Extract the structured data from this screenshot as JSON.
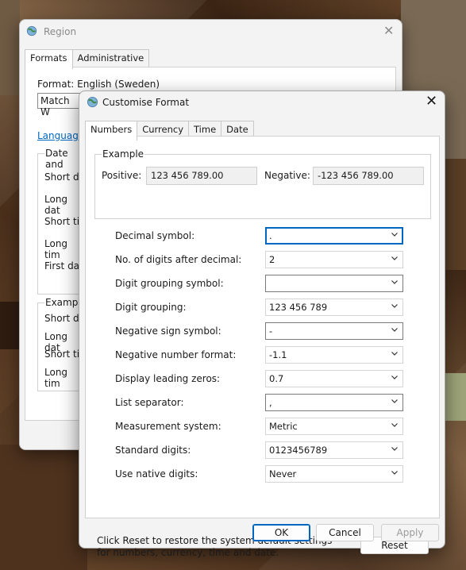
{
  "region_window": {
    "title": "Region",
    "tabs": [
      "Formats",
      "Administrative"
    ],
    "format_label": "Format: English (Sweden)",
    "format_select_value": "Match W",
    "language_link": "Language",
    "date_group_legend": "Date and",
    "date_rows": [
      "Short da",
      "Long dat",
      "Short tin",
      "Long tim",
      "First day"
    ],
    "examples_legend": "Example",
    "example_rows": [
      "Short da",
      "Long dat",
      "Short tin",
      "Long tim"
    ]
  },
  "dialog": {
    "title": "Customise Format",
    "tabs": [
      "Numbers",
      "Currency",
      "Time",
      "Date"
    ],
    "example": {
      "legend": "Example",
      "positive_label": "Positive:",
      "positive_value": "123 456 789.00",
      "negative_label": "Negative:",
      "negative_value": "-123 456 789.00"
    },
    "settings": [
      {
        "label": "Decimal symbol:",
        "value": ".",
        "editable": true,
        "focused": true
      },
      {
        "label": "No. of digits after decimal:",
        "value": "2",
        "editable": false,
        "focused": false
      },
      {
        "label": "Digit grouping symbol:",
        "value": "",
        "editable": true,
        "focused": false
      },
      {
        "label": "Digit grouping:",
        "value": "123 456 789",
        "editable": false,
        "focused": false
      },
      {
        "label": "Negative sign symbol:",
        "value": "-",
        "editable": true,
        "focused": false
      },
      {
        "label": "Negative number format:",
        "value": "-1.1",
        "editable": false,
        "focused": false
      },
      {
        "label": "Display leading zeros:",
        "value": "0.7",
        "editable": false,
        "focused": false
      },
      {
        "label": "List separator:",
        "value": ",",
        "editable": true,
        "focused": false
      },
      {
        "label": "Measurement system:",
        "value": "Metric",
        "editable": false,
        "focused": false
      },
      {
        "label": "Standard digits:",
        "value": "0123456789",
        "editable": false,
        "focused": false
      },
      {
        "label": "Use native digits:",
        "value": "Never",
        "editable": false,
        "focused": false
      }
    ],
    "reset_note": "Click Reset to restore the system default settings for numbers, currency, time and date.",
    "buttons": {
      "reset": "Reset",
      "ok": "OK",
      "cancel": "Cancel",
      "apply": "Apply"
    }
  },
  "icons": {
    "app": "globe-icon",
    "close": "close-icon",
    "dropdown": "chevron-down-icon"
  },
  "colors": {
    "accent": "#0067c0",
    "link": "#0067c0"
  }
}
